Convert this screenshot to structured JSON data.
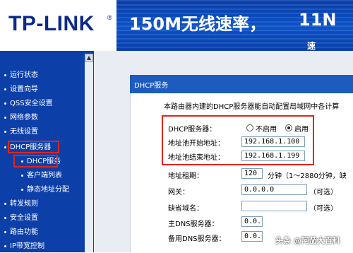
{
  "brand": {
    "logo_text": "TP-LINK",
    "reg_mark": "®"
  },
  "banner": {
    "text": "150M无线速率，",
    "suffix": "11N",
    "tail_mark": "速"
  },
  "sidebar": {
    "items": [
      {
        "label": "运行状态"
      },
      {
        "label": "设置向导"
      },
      {
        "label": "QSS安全设置"
      },
      {
        "label": "网络参数"
      },
      {
        "label": "无线设置"
      },
      {
        "label": "DHCP服务器"
      },
      {
        "label": "DHCP服务"
      },
      {
        "label": "客户端列表"
      },
      {
        "label": "静态地址分配"
      },
      {
        "label": "转发规则"
      },
      {
        "label": "安全设置"
      },
      {
        "label": "路由功能"
      },
      {
        "label": "IP带宽控制"
      }
    ],
    "scroll_up": "▲"
  },
  "panel": {
    "title": "DHCP服务",
    "description": "本路由器内建的DHCP服务器能自动配置局域网中各计算",
    "fields": {
      "dhcp_server_label": "DHCP服务器：",
      "disable_label": "不启用",
      "enable_label": "启用",
      "start_addr_label": "地址池开始地址：",
      "start_addr_value": "192.168.1.100",
      "end_addr_label": "地址池结束地址：",
      "end_addr_value": "192.168.1.199",
      "lease_label": "地址租期：",
      "lease_value": "120",
      "lease_hint": "分钟（1～2880分钟，缺",
      "gateway_label": "网关：",
      "gateway_value": "0.0.0.0",
      "gateway_hint": "（可选）",
      "domain_label": "缺省域名：",
      "domain_value": "",
      "domain_hint": "（可选）",
      "dns1_label": "主DNS服务器：",
      "dns1_value": "0.0.",
      "dns2_label": "备用DNS服务器：",
      "dns2_value": "0.0.0.0"
    }
  },
  "watermark": {
    "text": "头条 @阿茄大百科"
  },
  "colors": {
    "brand_blue": "#0b2a8a",
    "sidebar_blue": "#0d3fa9",
    "highlight_red": "#e0241b"
  }
}
